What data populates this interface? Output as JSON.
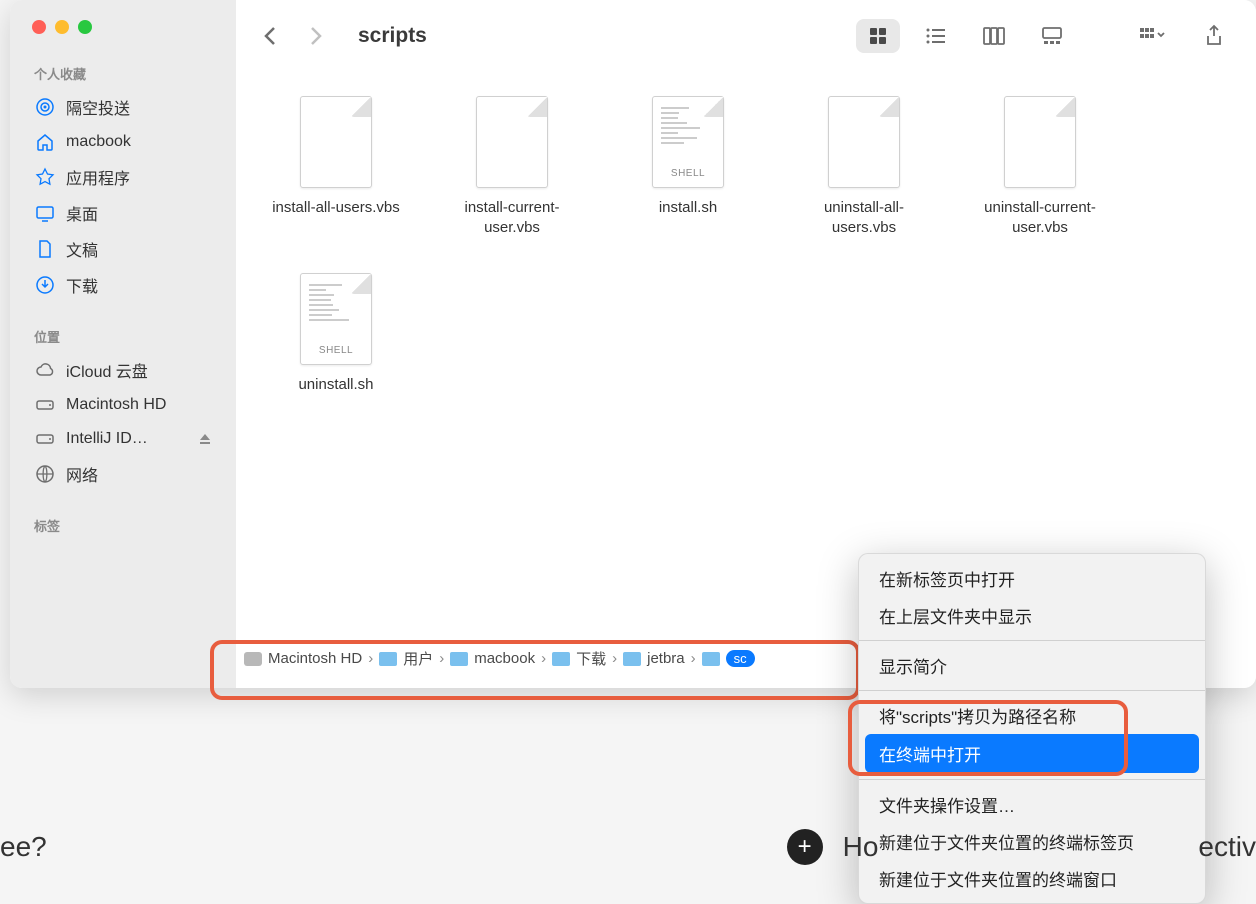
{
  "window_title": "scripts",
  "sidebar": {
    "sections": {
      "favorites_title": "个人收藏",
      "locations_title": "位置",
      "tags_title": "标签"
    },
    "favorites": [
      {
        "icon": "airdrop",
        "label": "隔空投送"
      },
      {
        "icon": "home",
        "label": "macbook"
      },
      {
        "icon": "apps",
        "label": "应用程序"
      },
      {
        "icon": "desktop",
        "label": "桌面"
      },
      {
        "icon": "doc",
        "label": "文稿"
      },
      {
        "icon": "download",
        "label": "下载"
      }
    ],
    "locations": [
      {
        "icon": "cloud",
        "label": "iCloud 云盘"
      },
      {
        "icon": "hd",
        "label": "Macintosh HD"
      },
      {
        "icon": "hd",
        "label": "IntelliJ ID…",
        "eject": true
      },
      {
        "icon": "network",
        "label": "网络"
      }
    ]
  },
  "files": [
    {
      "name": "install-all-users.vbs",
      "type": "blank"
    },
    {
      "name": "install-current-user.vbs",
      "type": "blank"
    },
    {
      "name": "install.sh",
      "type": "shell"
    },
    {
      "name": "uninstall-all-users.vbs",
      "type": "blank"
    },
    {
      "name": "uninstall-current-user.vbs",
      "type": "blank"
    },
    {
      "name": "uninstall.sh",
      "type": "shell"
    }
  ],
  "pathbar": [
    {
      "icon": "hd",
      "label": "Macintosh HD"
    },
    {
      "icon": "folder",
      "label": "用户"
    },
    {
      "icon": "folder",
      "label": "macbook"
    },
    {
      "icon": "folder",
      "label": "下载"
    },
    {
      "icon": "folder",
      "label": "jetbra"
    },
    {
      "icon": "folder-sel",
      "label": "sc"
    }
  ],
  "contextmenu": {
    "items": [
      {
        "label": "在新标签页中打开",
        "type": "item"
      },
      {
        "label": "在上层文件夹中显示",
        "type": "item"
      },
      {
        "type": "sep"
      },
      {
        "label": "显示简介",
        "type": "item"
      },
      {
        "type": "sep"
      },
      {
        "label": "将\"scripts\"拷贝为路径名称",
        "type": "item"
      },
      {
        "label": "在终端中打开",
        "type": "item",
        "highlighted": true
      },
      {
        "type": "sep"
      },
      {
        "label": "文件夹操作设置…",
        "type": "item"
      },
      {
        "label": "新建位于文件夹位置的终端标签页",
        "type": "item"
      },
      {
        "label": "新建位于文件夹位置的终端窗口",
        "type": "item"
      }
    ]
  },
  "bottom": {
    "left_frag": "ee?",
    "right_frag_1": "Ho",
    "right_frag_2": "ectiv"
  }
}
